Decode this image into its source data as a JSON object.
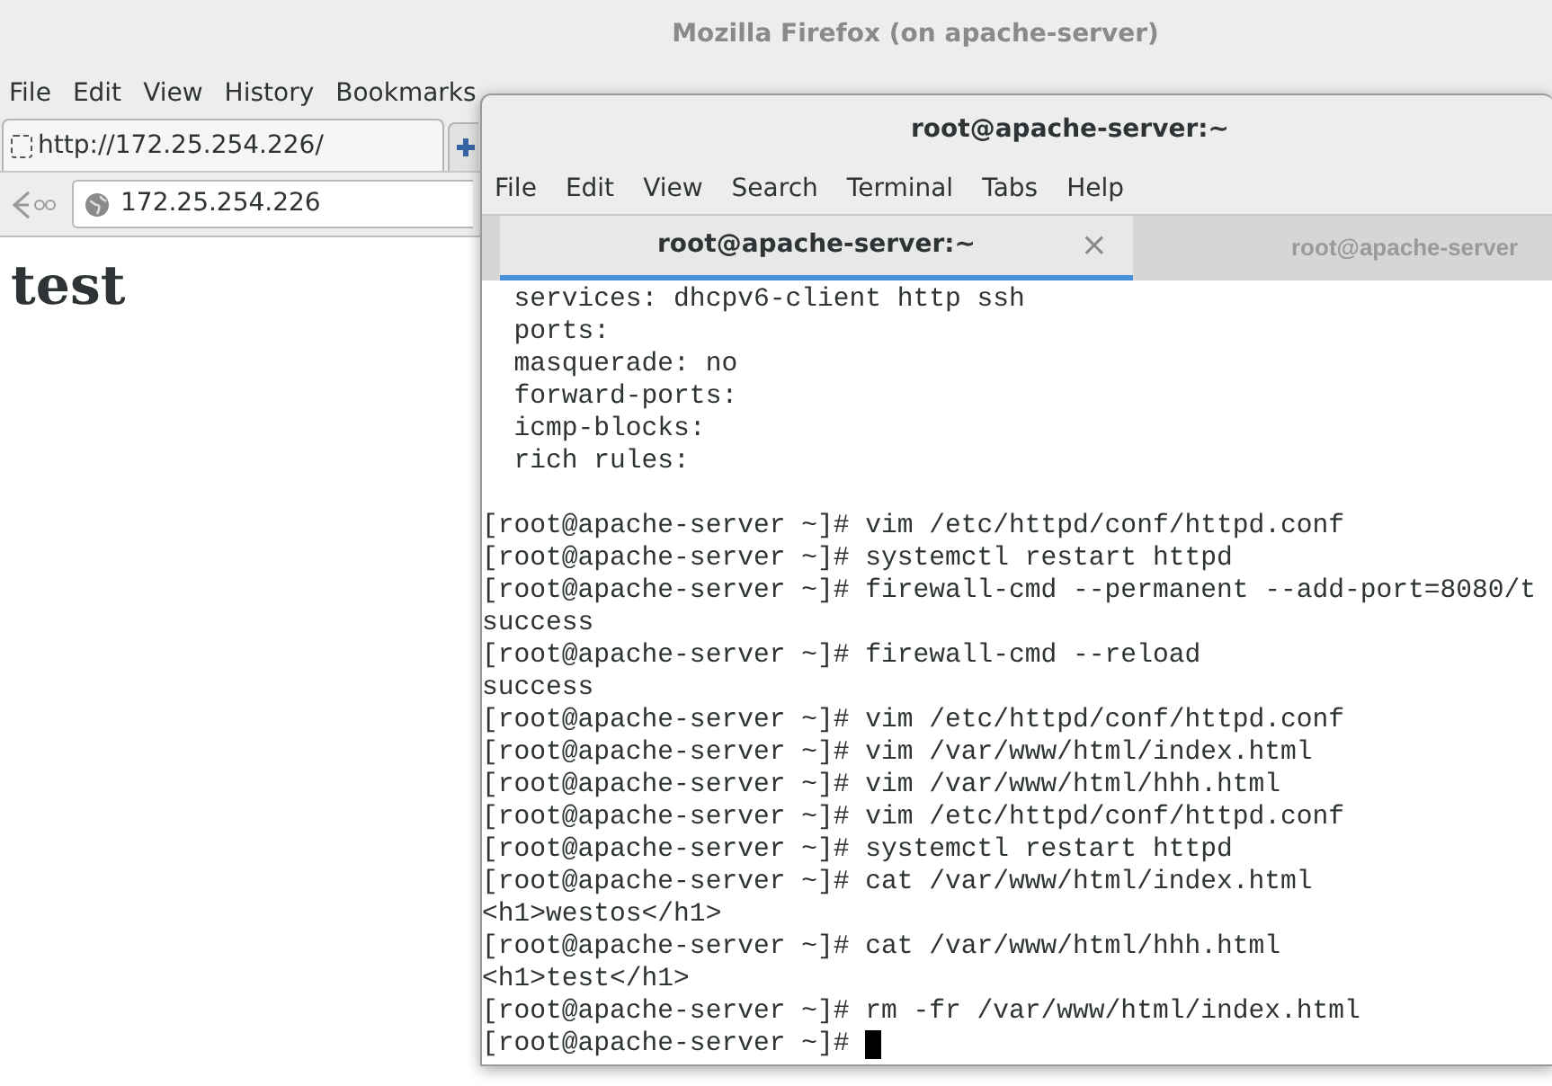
{
  "firefox": {
    "title": "Mozilla Firefox (on apache-server)",
    "menu": [
      "File",
      "Edit",
      "View",
      "History",
      "Bookmarks"
    ],
    "tab": {
      "title": "http://172.25.254.226/"
    },
    "url": "172.25.254.226",
    "page_heading": "test"
  },
  "terminal": {
    "title": "root@apache-server:~",
    "menu": [
      "File",
      "Edit",
      "View",
      "Search",
      "Terminal",
      "Tabs",
      "Help"
    ],
    "tabs": [
      {
        "label": "root@apache-server:~",
        "selected": true,
        "close": "×"
      },
      {
        "label": "root@apache-server",
        "selected": false
      }
    ],
    "blocks": [
      [
        "  services: dhcpv6-client http ssh",
        "  ports:",
        "  masquerade: no",
        "  forward-ports:",
        "  icmp-blocks:",
        "  rich rules:"
      ],
      [
        "[root@apache-server ~]# vim /etc/httpd/conf/httpd.conf",
        "[root@apache-server ~]# systemctl restart httpd",
        "[root@apache-server ~]# firewall-cmd --permanent --add-port=8080/t",
        "success",
        "[root@apache-server ~]# firewall-cmd --reload",
        "success",
        "[root@apache-server ~]# vim /etc/httpd/conf/httpd.conf",
        "[root@apache-server ~]# vim /var/www/html/index.html",
        "[root@apache-server ~]# vim /var/www/html/hhh.html",
        "[root@apache-server ~]# vim /etc/httpd/conf/httpd.conf",
        "[root@apache-server ~]# systemctl restart httpd",
        "[root@apache-server ~]# cat /var/www/html/index.html",
        "<h1>westos</h1>",
        "[root@apache-server ~]# cat /var/www/html/hhh.html",
        "<h1>test</h1>",
        "[root@apache-server ~]# rm -fr /var/www/html/index.html",
        "[root@apache-server ~]# "
      ]
    ]
  }
}
